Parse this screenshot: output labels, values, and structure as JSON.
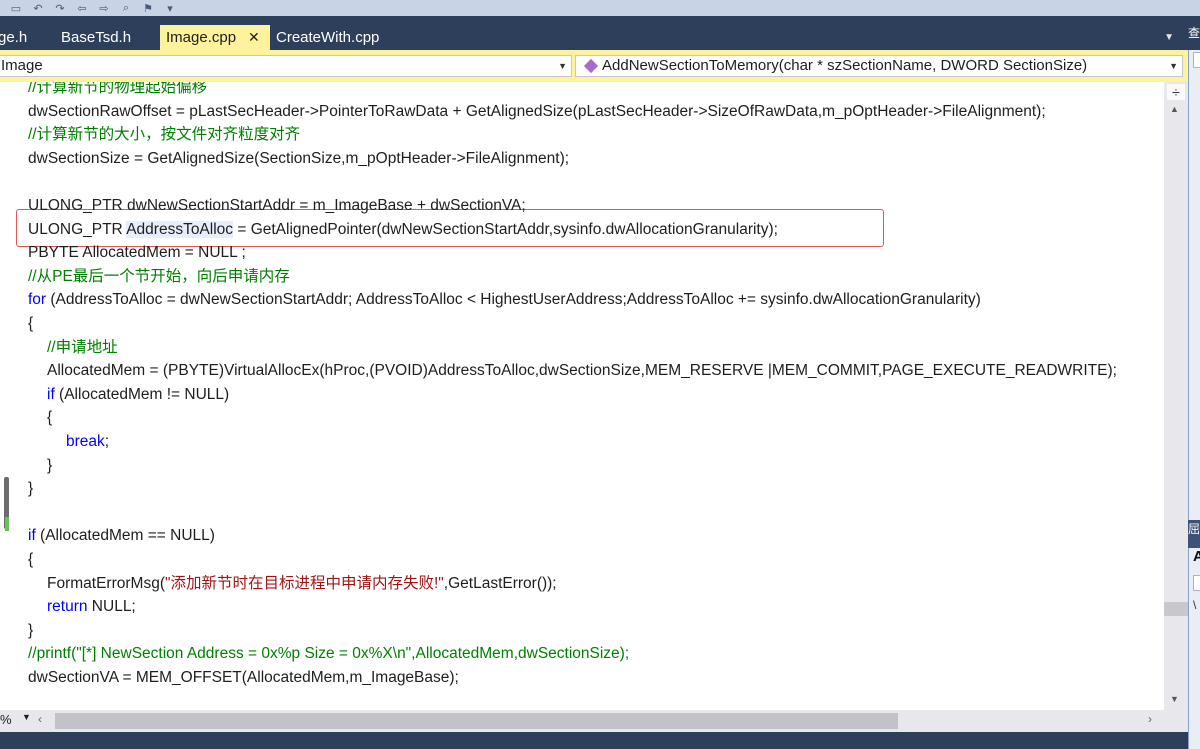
{
  "tabs": [
    {
      "label": "ge.h",
      "active": false
    },
    {
      "label": "BaseTsd.h",
      "active": false
    },
    {
      "label": "Image.cpp",
      "active": true
    },
    {
      "label": "CreateWith.cpp",
      "active": false
    }
  ],
  "tab_close_glyph": "✕",
  "nav": {
    "class_combo": "Image",
    "method_combo": "AddNewSectionToMemory(char * szSectionName, DWORD SectionSize)"
  },
  "zoom": "%",
  "code_lines": [
    {
      "indent": 0,
      "parts": [
        {
          "t": "cm",
          "v": "//计算新节的物理起始偏移"
        }
      ]
    },
    {
      "indent": 0,
      "parts": [
        {
          "t": "p",
          "v": "dwSectionRawOffset = pLastSecHeader->PointerToRawData + GetAlignedSize(pLastSecHeader->SizeOfRawData,m_pOptHeader->FileAlignment);"
        }
      ]
    },
    {
      "indent": 0,
      "parts": [
        {
          "t": "cm",
          "v": "//计算新节的大小，按文件对齐粒度对齐"
        }
      ]
    },
    {
      "indent": 0,
      "parts": [
        {
          "t": "p",
          "v": "dwSectionSize = GetAlignedSize(SectionSize,m_pOptHeader->FileAlignment);"
        }
      ]
    },
    {
      "indent": 0,
      "parts": []
    },
    {
      "indent": 0,
      "parts": [
        {
          "t": "p",
          "v": "ULONG_PTR dwNewSectionStartAddr = m_ImageBase + dwSectionVA;"
        }
      ]
    },
    {
      "indent": 0,
      "parts": [
        {
          "t": "p",
          "v": "ULONG_PTR "
        },
        {
          "t": "sel",
          "v": "AddressToAlloc"
        },
        {
          "t": "p",
          "v": " = GetAlignedPointer(dwNewSectionStartAddr,sysinfo.dwAllocationGranularity);"
        }
      ]
    },
    {
      "indent": 0,
      "parts": [
        {
          "t": "p",
          "v": "PBYTE AllocatedMem = NULL ;"
        }
      ]
    },
    {
      "indent": 0,
      "parts": [
        {
          "t": "cm",
          "v": "//从PE最后一个节开始，向后申请内存"
        }
      ]
    },
    {
      "indent": 0,
      "parts": [
        {
          "t": "kw",
          "v": "for"
        },
        {
          "t": "p",
          "v": " (AddressToAlloc = dwNewSectionStartAddr; AddressToAlloc < HighestUserAddress;AddressToAlloc += sysinfo.dwAllocationGranularity)"
        }
      ]
    },
    {
      "indent": 0,
      "parts": [
        {
          "t": "p",
          "v": "{"
        }
      ]
    },
    {
      "indent": 1,
      "parts": [
        {
          "t": "cm",
          "v": "//申请地址"
        }
      ]
    },
    {
      "indent": 1,
      "parts": [
        {
          "t": "p",
          "v": "AllocatedMem = (PBYTE)VirtualAllocEx(hProc,(PVOID)AddressToAlloc,dwSectionSize,MEM_RESERVE |MEM_COMMIT,PAGE_EXECUTE_READWRITE);"
        }
      ]
    },
    {
      "indent": 1,
      "parts": [
        {
          "t": "kw",
          "v": "if"
        },
        {
          "t": "p",
          "v": " (AllocatedMem != NULL)"
        }
      ]
    },
    {
      "indent": 1,
      "parts": [
        {
          "t": "p",
          "v": "{"
        }
      ]
    },
    {
      "indent": 2,
      "parts": [
        {
          "t": "kw",
          "v": "break"
        },
        {
          "t": "p",
          "v": ";"
        }
      ]
    },
    {
      "indent": 1,
      "parts": [
        {
          "t": "p",
          "v": "}"
        }
      ]
    },
    {
      "indent": 0,
      "parts": [
        {
          "t": "p",
          "v": "}"
        }
      ]
    },
    {
      "indent": 0,
      "parts": []
    },
    {
      "indent": 0,
      "parts": [
        {
          "t": "kw",
          "v": "if"
        },
        {
          "t": "p",
          "v": " (AllocatedMem == NULL)"
        }
      ]
    },
    {
      "indent": 0,
      "parts": [
        {
          "t": "p",
          "v": "{"
        }
      ]
    },
    {
      "indent": 1,
      "parts": [
        {
          "t": "p",
          "v": "FormatErrorMsg("
        },
        {
          "t": "str",
          "v": "\"添加新节时在目标进程中申请内存失败!\""
        },
        {
          "t": "p",
          "v": ",GetLastError());"
        }
      ]
    },
    {
      "indent": 1,
      "parts": [
        {
          "t": "kw",
          "v": "return"
        },
        {
          "t": "p",
          "v": " NULL;"
        }
      ]
    },
    {
      "indent": 0,
      "parts": [
        {
          "t": "p",
          "v": "}"
        }
      ]
    },
    {
      "indent": 0,
      "parts": [
        {
          "t": "cm",
          "v": "//printf(\"[*] NewSection Address = 0x%p Size = 0x%X\\n\",AllocatedMem,dwSectionSize);"
        }
      ]
    },
    {
      "indent": 0,
      "parts": [
        {
          "t": "p",
          "v": "dwSectionVA = MEM_OFFSET(AllocatedMem,m_ImageBase);"
        }
      ]
    }
  ],
  "right_panel": {
    "title_top": "查",
    "title_mid": "屈",
    "letter": "A",
    "letter2": "\\"
  },
  "colors": {
    "comment": "#008000",
    "keyword": "#0000ff",
    "string": "#a31515",
    "tab_active": "#fff29d",
    "highlight_box": "#e05a5a"
  }
}
